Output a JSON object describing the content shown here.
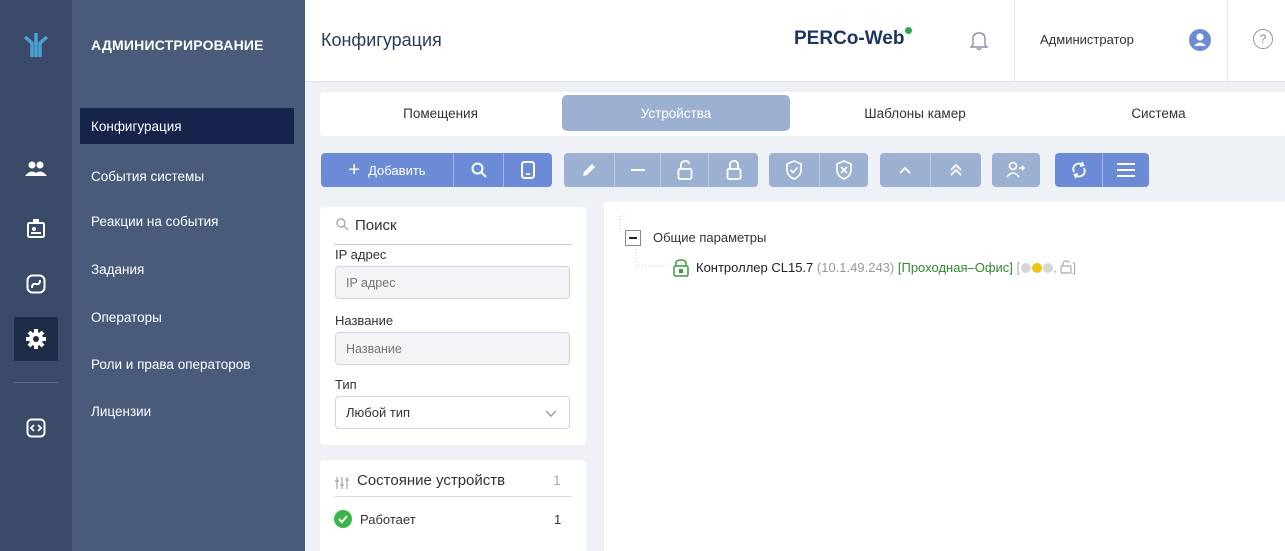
{
  "rail": {
    "icons": [
      "perco-logo-icon",
      "users-icon",
      "badge-icon",
      "route-icon",
      "gear-icon",
      "code-icon"
    ]
  },
  "menu": {
    "heading": "АДМИНИСТРИРОВАНИЕ",
    "items": [
      {
        "label": "Конфигурация",
        "active": true
      },
      {
        "label": "События системы"
      },
      {
        "label": "Реакции на события"
      },
      {
        "label": "Задания"
      },
      {
        "label": "Операторы"
      },
      {
        "label": "Роли и права операторов"
      },
      {
        "label": "Лицензии"
      }
    ]
  },
  "header": {
    "title": "Конфигурация",
    "brand": "PERCo-Web",
    "user": "Администратор",
    "help": "?"
  },
  "tabs": [
    {
      "label": "Помещения"
    },
    {
      "label": "Устройства",
      "active": true
    },
    {
      "label": "Шаблоны камер"
    },
    {
      "label": "Система"
    }
  ],
  "toolbar": {
    "add_label": "Добавить"
  },
  "filter": {
    "search_label": "Поиск",
    "ip_label": "IP адрес",
    "ip_placeholder": "IP адрес",
    "name_label": "Название",
    "name_placeholder": "Название",
    "type_label": "Тип",
    "type_value": "Любой тип"
  },
  "state": {
    "title": "Состояние устройств",
    "count": "1",
    "status_label": "Работает",
    "status_count": "1"
  },
  "tree": {
    "root_label": "Общие параметры",
    "node_name": "Контроллер CL15.7",
    "node_ip": "(10.1.49.243)",
    "node_room": "[Проходная–Офис]",
    "node_bracket_open": "[",
    "node_bracket_close": "]"
  },
  "colors": {
    "rail": "#3a4a68",
    "menu": "#4a5a7a",
    "menu_active": "#16234a",
    "tab_active": "#9cb1d2",
    "toolbar_primary": "#6b8bd6",
    "ok_green": "#3bb54a",
    "room_green": "#2e8b2e"
  }
}
